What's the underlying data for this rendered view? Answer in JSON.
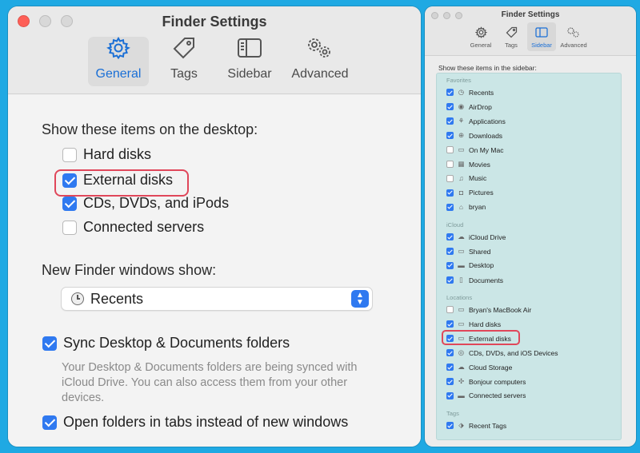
{
  "left_window": {
    "title": "Finder Settings",
    "tabs": [
      {
        "label": "General",
        "icon": "gear-icon",
        "active": true
      },
      {
        "label": "Tags",
        "icon": "tag-icon",
        "active": false
      },
      {
        "label": "Sidebar",
        "icon": "sidebar-icon",
        "active": false
      },
      {
        "label": "Advanced",
        "icon": "gears-icon",
        "active": false
      }
    ],
    "desktop_heading": "Show these items on the desktop:",
    "desktop_items": [
      {
        "label": "Hard disks",
        "checked": false
      },
      {
        "label": "External disks",
        "checked": true
      },
      {
        "label": "CDs, DVDs, and iPods",
        "checked": true
      },
      {
        "label": "Connected servers",
        "checked": false
      }
    ],
    "new_window_heading": "New Finder windows show:",
    "new_window_value": "Recents",
    "sync_label": "Sync Desktop & Documents folders",
    "sync_checked": true,
    "sync_description": "Your Desktop & Documents folders are being synced with iCloud Drive. You can also access them from your other devices.",
    "tabs_label": "Open folders in tabs instead of new windows",
    "tabs_checked": true
  },
  "right_window": {
    "title": "Finder Settings",
    "tabs": [
      {
        "label": "General",
        "icon": "gear-icon",
        "active": false
      },
      {
        "label": "Tags",
        "icon": "tag-icon",
        "active": false
      },
      {
        "label": "Sidebar",
        "icon": "sidebar-icon",
        "active": true
      },
      {
        "label": "Advanced",
        "icon": "gears-icon",
        "active": false
      }
    ],
    "sidebar_heading": "Show these items in the sidebar:",
    "sections": {
      "favorites": "Favorites",
      "icloud": "iCloud",
      "locations": "Locations",
      "tags": "Tags"
    },
    "favorites": [
      {
        "label": "Recents",
        "checked": true,
        "icon": "clock-icon"
      },
      {
        "label": "AirDrop",
        "checked": true,
        "icon": "airdrop-icon"
      },
      {
        "label": "Applications",
        "checked": true,
        "icon": "applications-icon"
      },
      {
        "label": "Downloads",
        "checked": true,
        "icon": "download-icon"
      },
      {
        "label": "On My Mac",
        "checked": false,
        "icon": "folder-icon"
      },
      {
        "label": "Movies",
        "checked": false,
        "icon": "film-icon"
      },
      {
        "label": "Music",
        "checked": false,
        "icon": "music-note-icon"
      },
      {
        "label": "Pictures",
        "checked": true,
        "icon": "camera-icon"
      },
      {
        "label": "bryan",
        "checked": true,
        "icon": "home-icon"
      }
    ],
    "icloud": [
      {
        "label": "iCloud Drive",
        "checked": true,
        "icon": "cloud-icon"
      },
      {
        "label": "Shared",
        "checked": true,
        "icon": "shared-folder-icon"
      },
      {
        "label": "Desktop",
        "checked": true,
        "icon": "desktop-icon"
      },
      {
        "label": "Documents",
        "checked": true,
        "icon": "document-icon"
      }
    ],
    "locations": [
      {
        "label": "Bryan's MacBook Air",
        "checked": false,
        "icon": "laptop-icon"
      },
      {
        "label": "Hard disks",
        "checked": true,
        "icon": "disk-icon"
      },
      {
        "label": "External disks",
        "checked": true,
        "icon": "external-disk-icon"
      },
      {
        "label": "CDs, DVDs, and iOS Devices",
        "checked": true,
        "icon": "cd-icon"
      },
      {
        "label": "Cloud Storage",
        "checked": true,
        "icon": "cloud-icon"
      },
      {
        "label": "Bonjour computers",
        "checked": true,
        "icon": "bonjour-icon"
      },
      {
        "label": "Connected servers",
        "checked": true,
        "icon": "server-icon"
      }
    ],
    "tags": [
      {
        "label": "Recent Tags",
        "checked": true,
        "icon": "tag-icon"
      }
    ]
  },
  "colors": {
    "background": "#1fa9e3",
    "accent": "#2f79f0",
    "highlight": "#e0475a",
    "sidebar_list": "#cbe6e6"
  }
}
